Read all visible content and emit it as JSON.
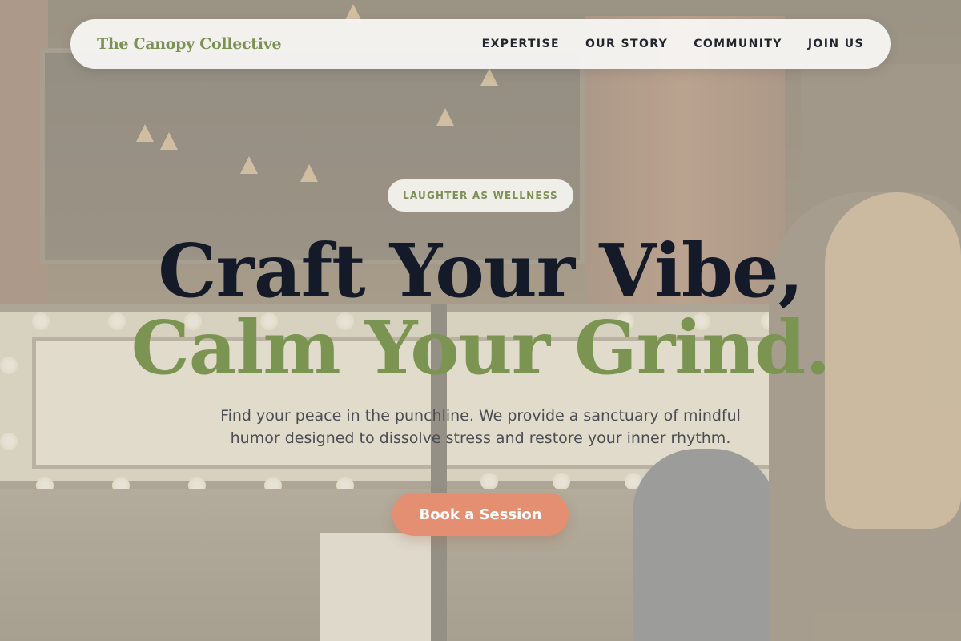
{
  "nav": {
    "brand": "The Canopy Collective",
    "links": [
      "EXPERTISE",
      "OUR STORY",
      "COMMUNITY",
      "JOIN US"
    ]
  },
  "hero": {
    "badge": "LAUGHTER AS WELLNESS",
    "headline_line1": "Craft Your Vibe,",
    "headline_line2": "Calm Your Grind.",
    "subtitle": "Find your peace in the punchline. We provide a sanctuary of mindful humor designed to dissolve stress and restore your inner rhythm.",
    "cta_label": "Book a Session"
  },
  "colors": {
    "brand_green": "#7c9254",
    "headline_dark": "#141a28",
    "cta_coral": "#e58f72"
  }
}
